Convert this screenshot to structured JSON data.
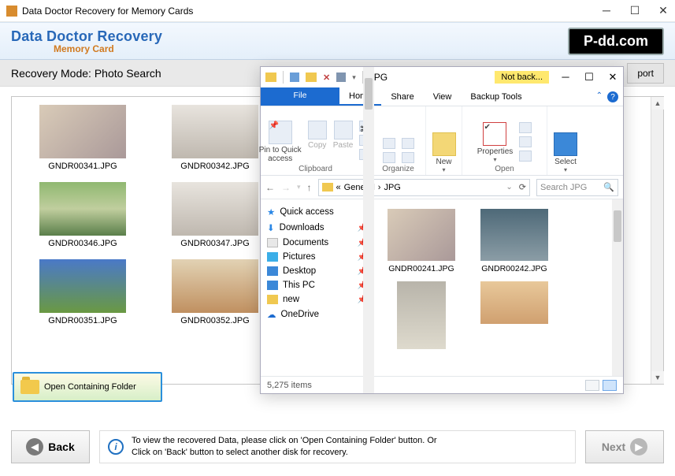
{
  "window": {
    "title": "Data Doctor Recovery for Memory Cards"
  },
  "banner": {
    "title": "Data Doctor Recovery",
    "subtitle": "Memory Card",
    "brand": "P-dd.com"
  },
  "modebar": {
    "label": "Recovery Mode: Photo Search",
    "partial_button": "port"
  },
  "thumbs": [
    {
      "file": "GNDR00341.JPG"
    },
    {
      "file": "GNDR00342.JPG"
    },
    {
      "file": "GNDR00346.JPG"
    },
    {
      "file": "GNDR00347.JPG"
    },
    {
      "file": "GNDR00351.JPG"
    },
    {
      "file": "GNDR00352.JPG"
    }
  ],
  "open_folder_btn": "Open Containing Folder",
  "footer": {
    "back": "Back",
    "next": "Next",
    "info_line1": "To view the recovered Data, please click on 'Open Containing Folder' button. Or",
    "info_line2": "Click on 'Back' button to select another disk for recovery."
  },
  "explorer": {
    "title": "JPG",
    "not_backed": "Not back...",
    "tabs": {
      "file": "File",
      "home": "Home",
      "share": "Share",
      "view": "View",
      "backup": "Backup Tools"
    },
    "ribbon": {
      "pin": "Pin to Quick access",
      "copy": "Copy",
      "paste": "Paste",
      "clipboard_label": "Clipboard",
      "organize_label": "Organize",
      "new": "New",
      "properties": "Properties",
      "open_label": "Open",
      "select": "Select"
    },
    "breadcrumb": {
      "root": "«",
      "p1": "General",
      "p2": "JPG"
    },
    "search_placeholder": "Search JPG",
    "tree": {
      "quick": "Quick access",
      "downloads": "Downloads",
      "documents": "Documents",
      "pictures": "Pictures",
      "desktop": "Desktop",
      "thispc": "This PC",
      "new": "new",
      "onedrive": "OneDrive"
    },
    "files": [
      {
        "name": "GNDR00241.JPG"
      },
      {
        "name": "GNDR00242.JPG"
      }
    ],
    "status": "5,275 items"
  }
}
